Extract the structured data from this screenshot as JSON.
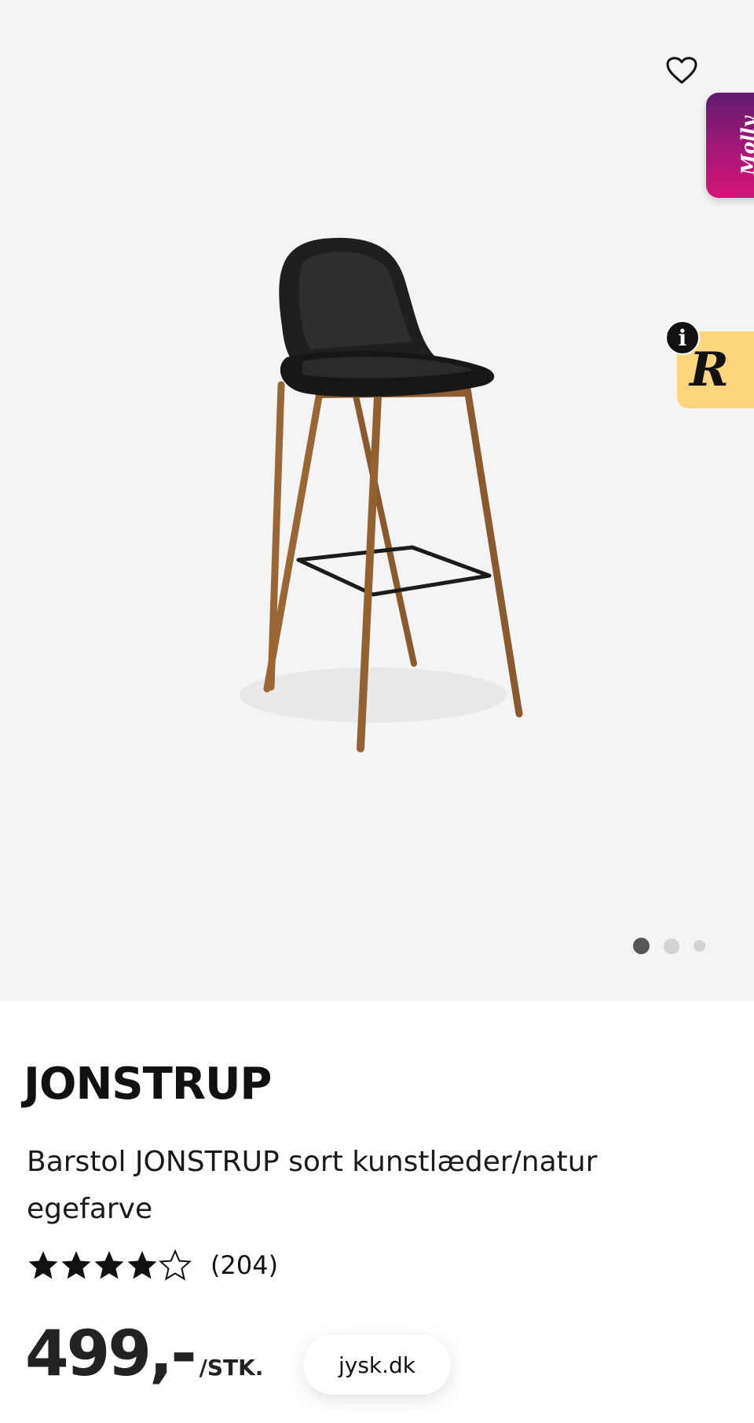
{
  "product": {
    "brand": "JONSTRUP",
    "description": "Barstol JONSTRUP sort kunstlæder/natur egefarve",
    "rating": 4,
    "rating_max": 5,
    "review_count": "(204)",
    "price": "499,-",
    "unit": "/STK."
  },
  "gallery": {
    "dot_count": 3,
    "active_index": 0
  },
  "widgets": {
    "molly_label": "Molly",
    "r_label": "R",
    "info_label": "i"
  },
  "browser": {
    "url": "jysk.dk"
  },
  "colors": {
    "gallery_bg": "#f5f4f4",
    "molly_gradient_start": "#5e1b6e",
    "molly_gradient_end": "#d41575",
    "r_tab_bg": "#ffd57d"
  },
  "icons": {
    "favorite": "heart-outline-icon",
    "star": "star-icon",
    "info": "info-icon"
  }
}
